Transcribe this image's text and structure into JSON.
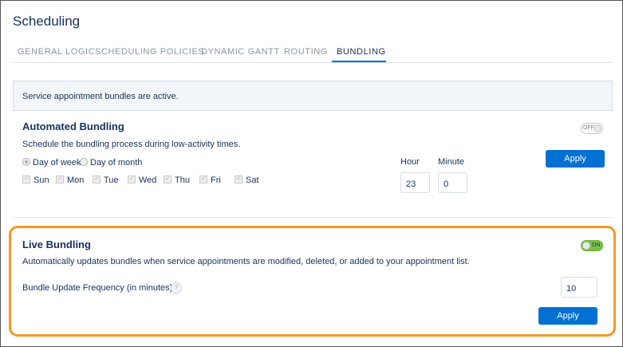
{
  "page": {
    "title": "Scheduling"
  },
  "tabs": [
    {
      "label": "GENERAL LOGIC"
    },
    {
      "label": "SCHEDULING POLICIES"
    },
    {
      "label": "DYNAMIC GANTT"
    },
    {
      "label": "ROUTING"
    },
    {
      "label": "BUNDLING"
    }
  ],
  "active_tab": "BUNDLING",
  "banner": {
    "text": "Service appointment bundles are active."
  },
  "automated": {
    "title": "Automated Bundling",
    "description": "Schedule the bundling process during low-activity times.",
    "toggle_label": "OFF",
    "toggle_state": "off",
    "radio_day_of_week": "Day of week",
    "radio_day_of_month": "Day of month",
    "selected_radio": "Day of week",
    "days": [
      {
        "label": "Sun",
        "checked": true
      },
      {
        "label": "Mon",
        "checked": true
      },
      {
        "label": "Tue",
        "checked": true
      },
      {
        "label": "Wed",
        "checked": true
      },
      {
        "label": "Thu",
        "checked": true
      },
      {
        "label": "Fri",
        "checked": true
      },
      {
        "label": "Sat",
        "checked": true
      }
    ],
    "hour_label": "Hour",
    "hour_value": "23",
    "minute_label": "Minute",
    "minute_value": "0",
    "apply_label": "Apply"
  },
  "live": {
    "title": "Live Bundling",
    "description": "Automatically updates bundles when service appointments are modified, deleted, or added to your appointment list.",
    "toggle_label": "ON",
    "toggle_state": "on",
    "frequency_label": "Bundle Update Frequency (in minutes)",
    "help_glyph": "?",
    "frequency_value": "10",
    "apply_label": "Apply"
  },
  "colors": {
    "accent": "#0070d2",
    "highlight": "#f59a23",
    "toggle_on": "#7ac143",
    "text": "#16325c"
  },
  "icons": {
    "help": "help-icon",
    "checkbox": "checkbox-icon",
    "radio": "radio-icon"
  }
}
